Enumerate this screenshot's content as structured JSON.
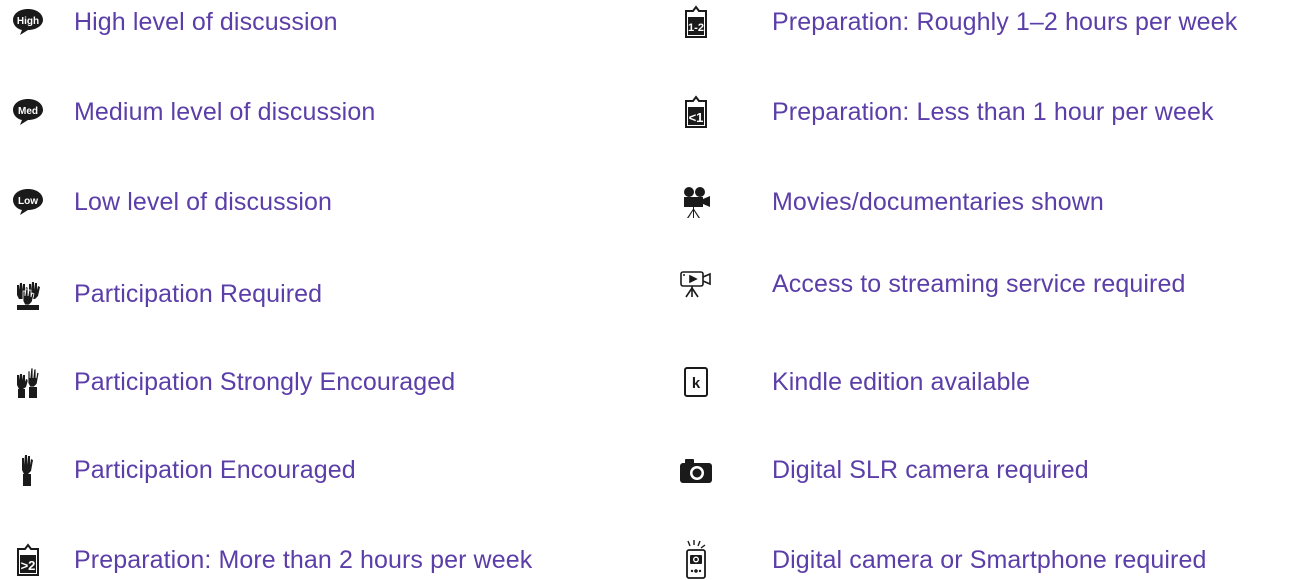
{
  "legend": {
    "left": [
      {
        "icon": "high-discussion-icon",
        "label": "High level of discussion",
        "badge": "High"
      },
      {
        "icon": "medium-discussion-icon",
        "label": "Medium level of discussion",
        "badge": "Med"
      },
      {
        "icon": "low-discussion-icon",
        "label": "Low level of discussion",
        "badge": "Low"
      },
      {
        "icon": "participation-required-icon",
        "label": "Participation Required"
      },
      {
        "icon": "participation-strongly-encouraged-icon",
        "label": "Participation Strongly Encouraged"
      },
      {
        "icon": "participation-encouraged-icon",
        "label": "Participation Encouraged"
      },
      {
        "icon": "preparation-more-than-2-icon",
        "label": "Preparation: More than 2 hours per week",
        "badge": ">2"
      }
    ],
    "right": [
      {
        "icon": "preparation-1-2-icon",
        "label": "Preparation: Roughly 1–2 hours per week",
        "badge": "1-2"
      },
      {
        "icon": "preparation-less-than-1-icon",
        "label": "Preparation: Less than 1 hour per week",
        "badge": "<1"
      },
      {
        "icon": "movie-camera-icon",
        "label": "Movies/documentaries shown"
      },
      {
        "icon": "streaming-camera-icon",
        "label": "Access to streaming service required"
      },
      {
        "icon": "kindle-icon",
        "label": "Kindle edition available",
        "badge": "k"
      },
      {
        "icon": "slr-camera-icon",
        "label": "Digital SLR camera required"
      },
      {
        "icon": "smartphone-camera-icon",
        "label": "Digital camera or Smartphone required"
      }
    ]
  },
  "colors": {
    "label": "#5b3ea8",
    "icon": "#1a1a1a"
  }
}
